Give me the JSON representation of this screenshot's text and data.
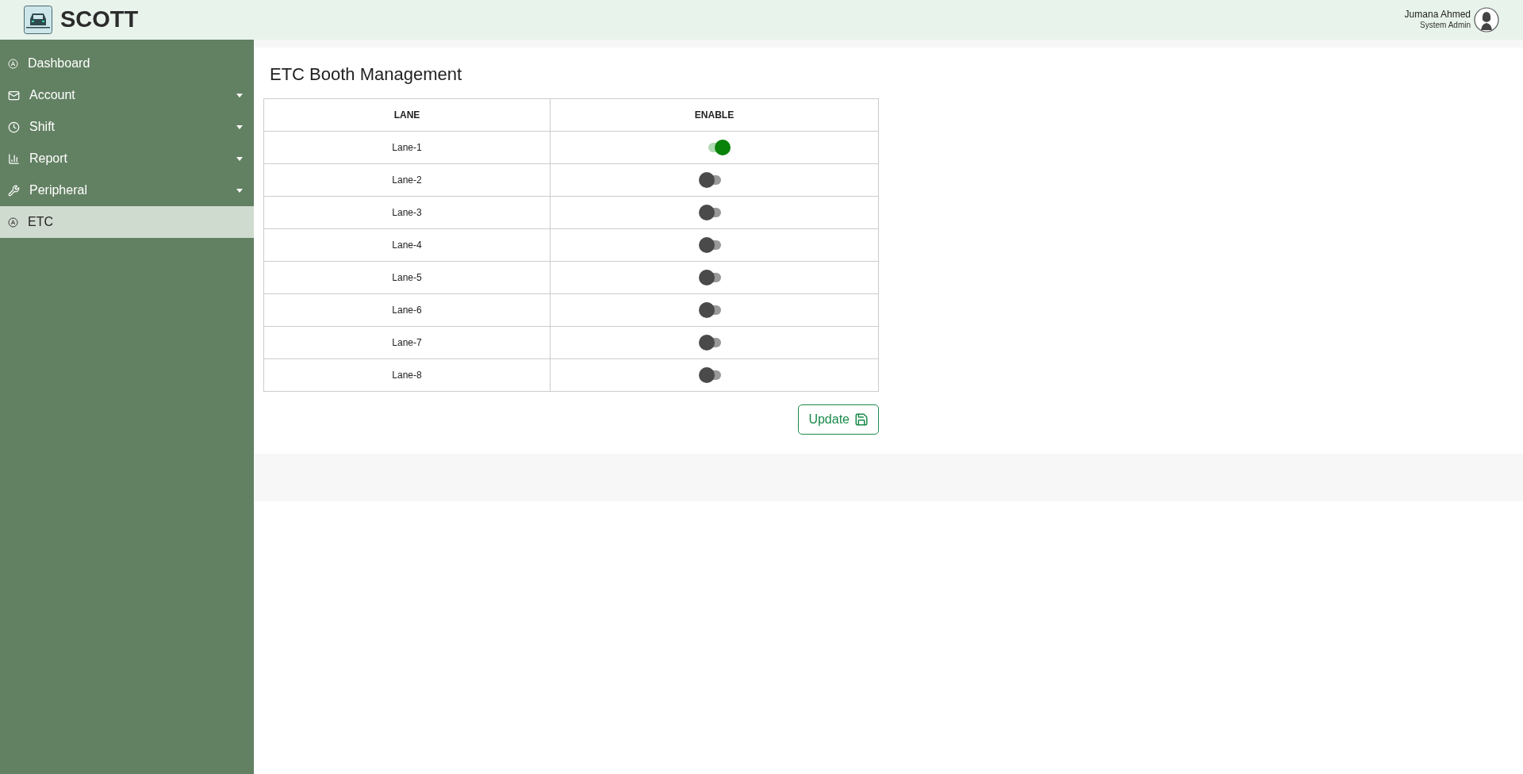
{
  "header": {
    "brand": "SCOTT",
    "user": {
      "name": "Jumana Ahmed",
      "role": "System Admin"
    }
  },
  "sidebar": {
    "items": [
      {
        "label": "Dashboard",
        "kind": "dashboard",
        "expandable": false,
        "selected": false
      },
      {
        "label": "Account",
        "kind": "account",
        "expandable": true,
        "selected": false
      },
      {
        "label": "Shift",
        "kind": "shift",
        "expandable": true,
        "selected": false
      },
      {
        "label": "Report",
        "kind": "report",
        "expandable": true,
        "selected": false
      },
      {
        "label": "Peripheral",
        "kind": "peripheral",
        "expandable": true,
        "selected": false
      },
      {
        "label": "ETC",
        "kind": "etc",
        "expandable": false,
        "selected": true
      }
    ]
  },
  "page": {
    "title": "ETC Booth Management"
  },
  "table": {
    "columns": [
      "LANE",
      "ENABLE"
    ],
    "rows": [
      {
        "lane": "Lane-1",
        "enabled": true
      },
      {
        "lane": "Lane-2",
        "enabled": false
      },
      {
        "lane": "Lane-3",
        "enabled": false
      },
      {
        "lane": "Lane-4",
        "enabled": false
      },
      {
        "lane": "Lane-5",
        "enabled": false
      },
      {
        "lane": "Lane-6",
        "enabled": false
      },
      {
        "lane": "Lane-7",
        "enabled": false
      },
      {
        "lane": "Lane-8",
        "enabled": false
      }
    ]
  },
  "update_button": "Update"
}
